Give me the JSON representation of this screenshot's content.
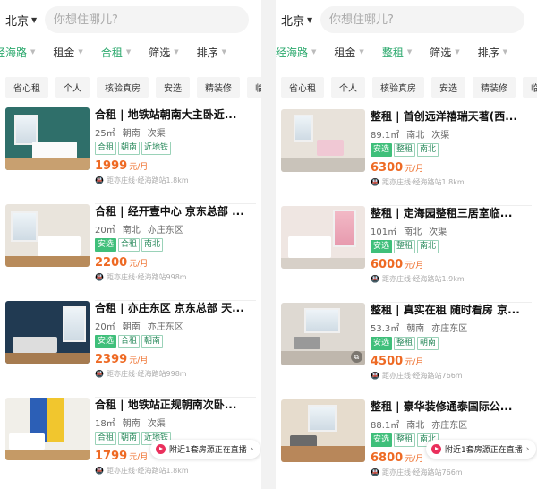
{
  "colors": {
    "accent": "#2aa86c",
    "price": "#ee6a24",
    "live": "#ea2f5c"
  },
  "panels": [
    {
      "city": "北京",
      "search_placeholder": "你想住哪儿?",
      "filters": [
        "经海路",
        "租金",
        "合租",
        "筛选",
        "排序"
      ],
      "active_filters": [
        0,
        2
      ],
      "chips": [
        "省心租",
        "个人",
        "核验真房",
        "安选",
        "精装修",
        "临地铁"
      ],
      "listings": [
        {
          "title": "合租 | 地铁站朝南大主卧近...",
          "area": "25㎡",
          "orient": "朝南",
          "extra": "次渠",
          "badges": [
            "合租",
            "朝南",
            "近地铁"
          ],
          "solid": [],
          "price": "1999",
          "unit": "元/月",
          "distance": "距亦庄线·经海路站1.8km"
        },
        {
          "title": "合租 | 经开壹中心 京东总部 ...",
          "area": "20㎡",
          "orient": "南北",
          "extra": "亦庄东区",
          "badges": [
            "安选",
            "合租",
            "南北"
          ],
          "solid": [
            0
          ],
          "price": "2200",
          "unit": "元/月",
          "distance": "距亦庄线·经海路站998m"
        },
        {
          "title": "合租 | 亦庄东区 京东总部 天...",
          "area": "20㎡",
          "orient": "朝南",
          "extra": "亦庄东区",
          "badges": [
            "安选",
            "合租",
            "朝南"
          ],
          "solid": [
            0
          ],
          "price": "2399",
          "unit": "元/月",
          "distance": "距亦庄线·经海路站998m"
        },
        {
          "title": "合租 | 地铁站正规朝南次卧...",
          "area": "18㎡",
          "orient": "朝南",
          "extra": "次渠",
          "badges": [
            "合租",
            "朝南",
            "近地铁"
          ],
          "solid": [],
          "price": "1799",
          "unit": "元/月",
          "distance": "距亦庄线·经海路站1.8km"
        }
      ],
      "live_banner": "附近1套房源正在直播"
    },
    {
      "city": "北京",
      "search_placeholder": "你想住哪儿?",
      "filters": [
        "经海路",
        "租金",
        "整租",
        "筛选",
        "排序"
      ],
      "active_filters": [
        0,
        2
      ],
      "chips": [
        "省心租",
        "个人",
        "核验真房",
        "安选",
        "精装修",
        "临地铁"
      ],
      "listings": [
        {
          "title": "整租 | 首创远洋禧瑞天著(西...",
          "area": "89.1㎡",
          "orient": "南北",
          "extra": "次渠",
          "badges": [
            "安选",
            "整租",
            "南北"
          ],
          "solid": [
            0
          ],
          "price": "6300",
          "unit": "元/月",
          "distance": "距亦庄线·经海路站1.8km"
        },
        {
          "title": "整租 | 定海园整租三居室临...",
          "area": "101㎡",
          "orient": "南北",
          "extra": "次渠",
          "badges": [
            "安选",
            "整租",
            "南北"
          ],
          "solid": [
            0
          ],
          "price": "6000",
          "unit": "元/月",
          "distance": "距亦庄线·经海路站1.9km"
        },
        {
          "title": "整租 | 真实在租 随时看房 京...",
          "area": "53.3㎡",
          "orient": "朝南",
          "extra": "亦庄东区",
          "badges": [
            "安选",
            "整租",
            "朝南"
          ],
          "solid": [
            0
          ],
          "price": "4500",
          "unit": "元/月",
          "distance": "距亦庄线·经海路站766m"
        },
        {
          "title": "整租 | 豪华装修通泰国际公...",
          "area": "88.1㎡",
          "orient": "南北",
          "extra": "亦庄东区",
          "badges": [
            "安选",
            "整租",
            "南北"
          ],
          "solid": [
            0
          ],
          "price": "6800",
          "unit": "元/月",
          "distance": "距亦庄线·经海路站766m"
        }
      ],
      "live_banner": "附近1套房源正在直播"
    }
  ]
}
